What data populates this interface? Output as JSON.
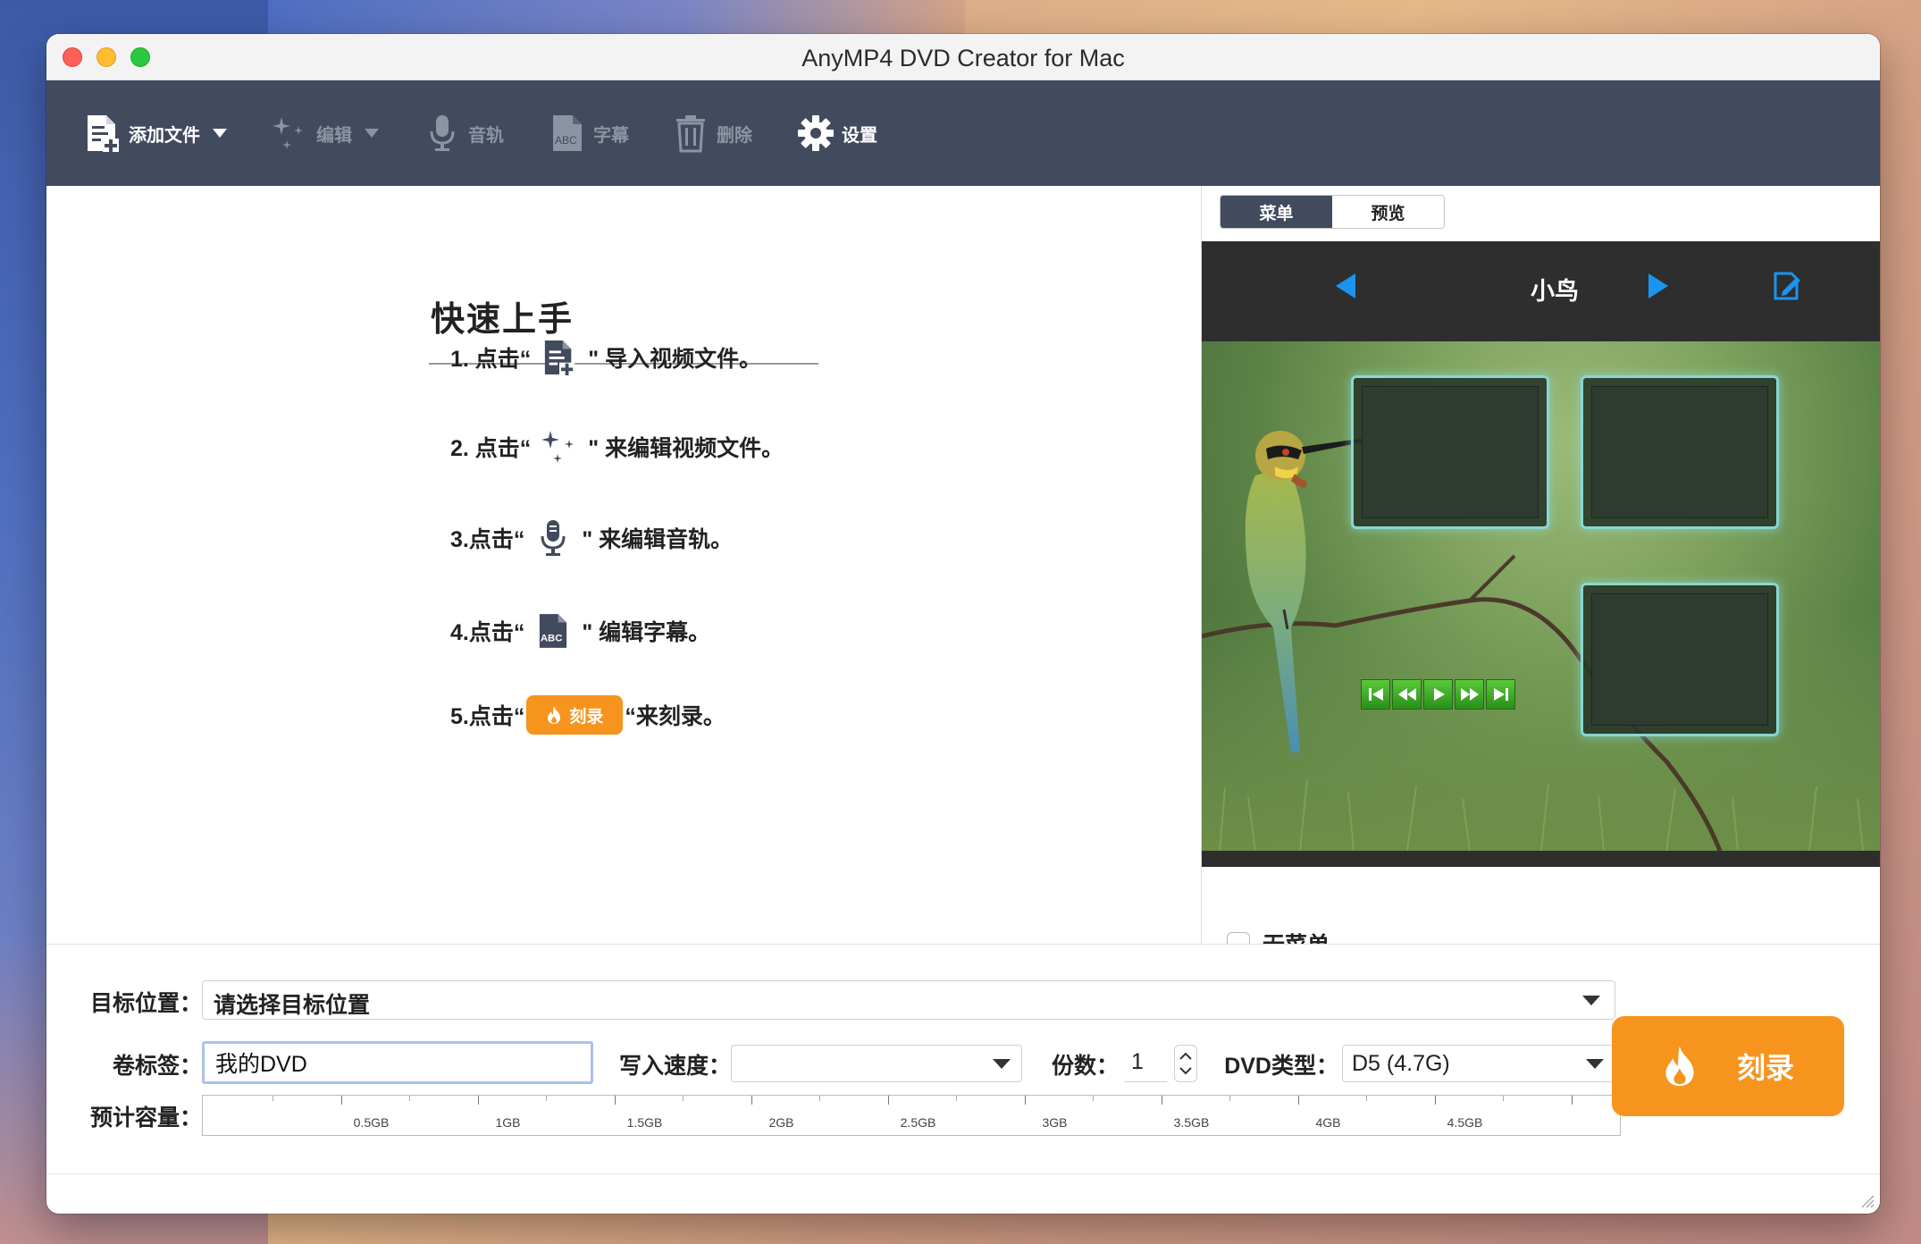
{
  "window": {
    "title": "AnyMP4 DVD Creator for Mac"
  },
  "toolbar": {
    "add_files": "添加文件",
    "edit": "编辑",
    "audio": "音轨",
    "subtitle": "字幕",
    "delete": "删除",
    "settings": "设置"
  },
  "guide": {
    "title": "快速上手",
    "steps": [
      {
        "prefix": "1. 点击“",
        "suffix": "\" 导入视频文件。",
        "icon": "add-file-icon"
      },
      {
        "prefix": "2. 点击“",
        "suffix": "\" 来编辑视频文件。",
        "icon": "magic-wand-icon"
      },
      {
        "prefix": "3.点击“",
        "suffix": "\" 来编辑音轨。",
        "icon": "microphone-icon"
      },
      {
        "prefix": "4.点击“",
        "suffix": "\" 编辑字幕。",
        "icon": "subtitle-icon"
      },
      {
        "prefix": "5.点击“",
        "suffix": "“来刻录。",
        "icon": "burn-icon",
        "button": "刻录"
      }
    ]
  },
  "menu_panel": {
    "tabs": [
      "菜单",
      "预览"
    ],
    "active_tab": "菜单",
    "template_name": "小鸟",
    "no_menu_label": "无菜单",
    "no_menu_checked": false
  },
  "bottom": {
    "destination_label": "目标位置：",
    "destination_value": "请选择目标位置",
    "volume_label_label": "卷标签：",
    "volume_label_value": "我的DVD",
    "write_speed_label": "写入速度：",
    "write_speed_value": "",
    "copies_label": "份数：",
    "copies_value": "1",
    "dvd_type_label": "DVD类型：",
    "dvd_type_value": "D5 (4.7G)",
    "capacity_label": "预计容量：",
    "capacity_scale": [
      "0.5GB",
      "1GB",
      "1.5GB",
      "2GB",
      "2.5GB",
      "3GB",
      "3.5GB",
      "4GB",
      "4.5GB"
    ],
    "burn_label": "刻录"
  },
  "colors": {
    "toolbar_bg": "#424a5e",
    "accent_orange": "#f7941d",
    "nav_blue": "#1a94f0"
  }
}
